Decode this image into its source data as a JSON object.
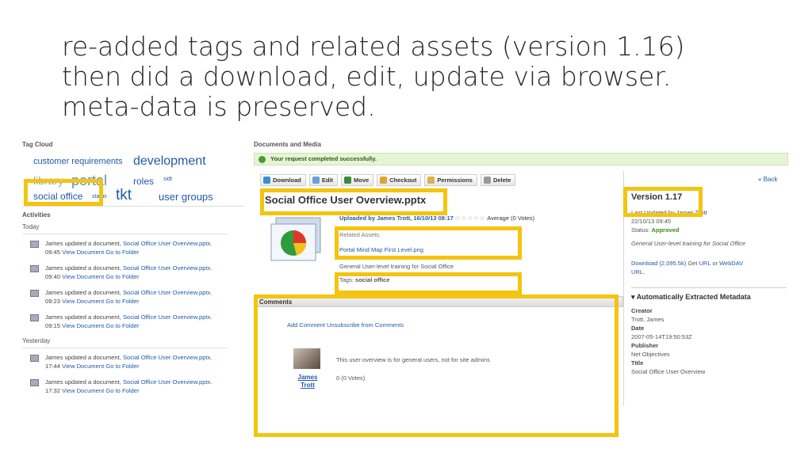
{
  "slide": {
    "title_lines": [
      "re-added tags and related assets (version 1.16)",
      "then did a download, edit, update via browser.",
      "meta-data is preserved."
    ]
  },
  "tag_cloud": {
    "heading": "Tag Cloud",
    "tags": [
      "customer requirements",
      "development",
      "library",
      "portal",
      "roles",
      "sidt",
      "social office",
      "status",
      "tkt",
      "user groups"
    ]
  },
  "activities": {
    "heading": "Activities",
    "today_label": "Today",
    "yesterday_label": "Yesterday",
    "items": [
      {
        "prefix": "James updated a document, ",
        "doc": "Social Office User Overview.pptx.",
        "time": "09:45",
        "links": "View Document Go to Folder"
      },
      {
        "prefix": "James updated a document, ",
        "doc": "Social Office User Overview.pptx.",
        "time": "09:40",
        "links": "View Document Go to Folder"
      },
      {
        "prefix": "James updated a document, ",
        "doc": "Social Office User Overview.pptx.",
        "time": "09:23",
        "links": "View Document Go to Folder"
      },
      {
        "prefix": "James updated a document, ",
        "doc": "Social Office User Overview.pptx.",
        "time": "09:15",
        "links": "View Document Go to Folder"
      },
      {
        "prefix": "James updated a document, ",
        "doc": "Social Office User Overview.pptx.",
        "time": "17:44",
        "links": "View Document Go to Folder"
      },
      {
        "prefix": "James updated a document, ",
        "doc": "Social Office User Overview.pptx.",
        "time": "17:32",
        "links": "View Document Go to Folder"
      }
    ]
  },
  "documents": {
    "heading": "Documents and Media",
    "success": "Your request completed successfully.",
    "toolbar": [
      "Download",
      "Edit",
      "Move",
      "Checkout",
      "Permissions",
      "Delete"
    ],
    "back": "« Back",
    "title": "Social Office User Overview.pptx",
    "uploaded": "Uploaded by James Trott, 16/10/13 08:17",
    "stars": "☆☆☆☆☆",
    "average": "Average (0 Votes)",
    "related_label": "Related Assets:",
    "related_item": "Portal Mind Map First Level.png",
    "description": "General User-level training for Social Office",
    "tags_label": "Tags:",
    "tag_value": "social office"
  },
  "comments": {
    "heading": "Comments",
    "add": "Add Comment",
    "unsubscribe": "Unsubscribe from Comments",
    "user_first": "James",
    "user_last": "Trott",
    "body": "This user overview is for general users, not for site admins",
    "votes": "0 (0 Votes)"
  },
  "version_panel": {
    "version": "Version 1.17",
    "updated_by": "Last Updated by James Trott",
    "date": "22/10/13 09:45",
    "status_label": "Status:",
    "status": "Approved",
    "description": "General User-level training for Social Office",
    "download": "Download (2,095.5k)",
    "get": "Get",
    "url": "URL",
    "or": "or",
    "webdav": "WebDAV",
    "webdav_url": "URL.",
    "extracted_heading": "Automatically Extracted Metadata",
    "fields": [
      {
        "k": "Creator",
        "v": "Trott, James"
      },
      {
        "k": "Date",
        "v": "2007-05-14T19:50:53Z"
      },
      {
        "k": "Publisher",
        "v": "Net Objectives"
      },
      {
        "k": "Title",
        "v": "Social Office User Overview"
      }
    ]
  }
}
